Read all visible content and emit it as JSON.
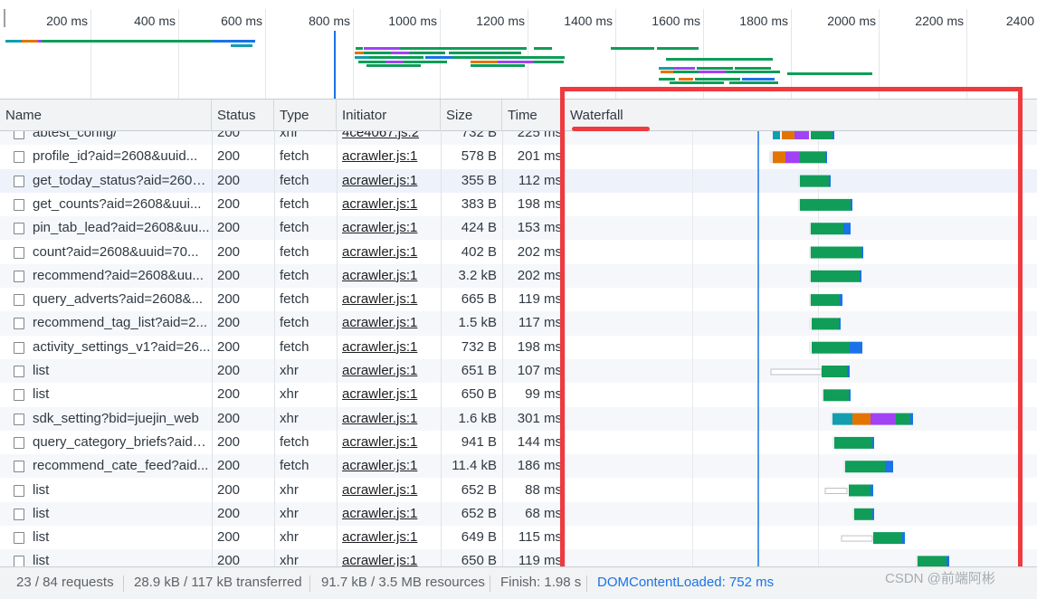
{
  "overview": {
    "ticks": [
      "200 ms",
      "400 ms",
      "600 ms",
      "800 ms",
      "1000 ms",
      "1200 ms",
      "1400 ms",
      "1600 ms",
      "1800 ms",
      "2000 ms",
      "2200 ms",
      "2400"
    ]
  },
  "columns": {
    "name": "Name",
    "status": "Status",
    "type": "Type",
    "initiator": "Initiator",
    "size": "Size",
    "time": "Time",
    "waterfall": "Waterfall"
  },
  "rows": [
    {
      "name": "abtest_config/",
      "status": "200",
      "type": "xhr",
      "initiator": "4ce4067.js:2",
      "size": "732 B",
      "time": "225 ms"
    },
    {
      "name": "profile_id?aid=2608&uuid...",
      "status": "200",
      "type": "fetch",
      "initiator": "acrawler.js:1",
      "size": "578 B",
      "time": "201 ms"
    },
    {
      "name": "get_today_status?aid=2608...",
      "status": "200",
      "type": "fetch",
      "initiator": "acrawler.js:1",
      "size": "355 B",
      "time": "112 ms"
    },
    {
      "name": "get_counts?aid=2608&uui...",
      "status": "200",
      "type": "fetch",
      "initiator": "acrawler.js:1",
      "size": "383 B",
      "time": "198 ms"
    },
    {
      "name": "pin_tab_lead?aid=2608&uu...",
      "status": "200",
      "type": "fetch",
      "initiator": "acrawler.js:1",
      "size": "424 B",
      "time": "153 ms"
    },
    {
      "name": "count?aid=2608&uuid=70...",
      "status": "200",
      "type": "fetch",
      "initiator": "acrawler.js:1",
      "size": "402 B",
      "time": "202 ms"
    },
    {
      "name": "recommend?aid=2608&uu...",
      "status": "200",
      "type": "fetch",
      "initiator": "acrawler.js:1",
      "size": "3.2 kB",
      "time": "202 ms"
    },
    {
      "name": "query_adverts?aid=2608&...",
      "status": "200",
      "type": "fetch",
      "initiator": "acrawler.js:1",
      "size": "665 B",
      "time": "119 ms"
    },
    {
      "name": "recommend_tag_list?aid=2...",
      "status": "200",
      "type": "fetch",
      "initiator": "acrawler.js:1",
      "size": "1.5 kB",
      "time": "117 ms"
    },
    {
      "name": "activity_settings_v1?aid=26...",
      "status": "200",
      "type": "fetch",
      "initiator": "acrawler.js:1",
      "size": "732 B",
      "time": "198 ms"
    },
    {
      "name": "list",
      "status": "200",
      "type": "xhr",
      "initiator": "acrawler.js:1",
      "size": "651 B",
      "time": "107 ms"
    },
    {
      "name": "list",
      "status": "200",
      "type": "xhr",
      "initiator": "acrawler.js:1",
      "size": "650 B",
      "time": "99 ms"
    },
    {
      "name": "sdk_setting?bid=juejin_web",
      "status": "200",
      "type": "xhr",
      "initiator": "acrawler.js:1",
      "size": "1.6 kB",
      "time": "301 ms"
    },
    {
      "name": "query_category_briefs?aid=...",
      "status": "200",
      "type": "fetch",
      "initiator": "acrawler.js:1",
      "size": "941 B",
      "time": "144 ms"
    },
    {
      "name": "recommend_cate_feed?aid...",
      "status": "200",
      "type": "fetch",
      "initiator": "acrawler.js:1",
      "size": "11.4 kB",
      "time": "186 ms"
    },
    {
      "name": "list",
      "status": "200",
      "type": "xhr",
      "initiator": "acrawler.js:1",
      "size": "652 B",
      "time": "88 ms"
    },
    {
      "name": "list",
      "status": "200",
      "type": "xhr",
      "initiator": "acrawler.js:1",
      "size": "652 B",
      "time": "68 ms"
    },
    {
      "name": "list",
      "status": "200",
      "type": "xhr",
      "initiator": "acrawler.js:1",
      "size": "649 B",
      "time": "115 ms"
    },
    {
      "name": "list",
      "status": "200",
      "type": "xhr",
      "initiator": "acrawler.js:1",
      "size": "650 B",
      "time": "119 ms"
    }
  ],
  "status_bar": {
    "requests": "23 / 84 requests",
    "transferred": "28.9 kB / 117 kB transferred",
    "resources": "91.7 kB / 3.5 MB resources",
    "finish": "Finish: 1.98 s",
    "dom_content_loaded": "DOMContentLoaded: 752 ms"
  },
  "watermark": "CSDN @前端阿彬",
  "colors": {
    "waiting": "#0f9d58",
    "download": "#1a73e8",
    "queue": "#ffffff",
    "ssl": "#a142f4",
    "connect": "#e37400",
    "dns": "#129eaf",
    "highlight": "#ef3a3f",
    "dcl_line": "#1a73e8"
  }
}
